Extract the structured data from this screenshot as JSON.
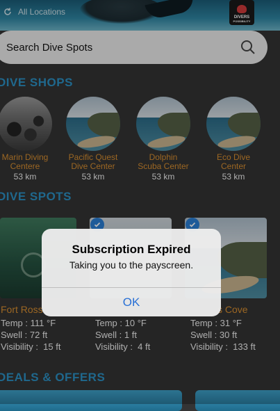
{
  "header": {
    "location_label": "All Locations",
    "badge_text_1": "DIVERS",
    "badge_text_2": "POSSIBILITY"
  },
  "search": {
    "placeholder": "Search Dive Spots"
  },
  "sections": {
    "shops": "DIVE SHOPS",
    "spots": "DIVE SPOTS",
    "deals": "DEALS & OFFERS"
  },
  "shops": [
    {
      "name_line1": "Marin Diving",
      "name_line2": "Centere",
      "distance": "53 km"
    },
    {
      "name_line1": "Pacific Quest",
      "name_line2": "Dive Center",
      "distance": "53 km"
    },
    {
      "name_line1": "Dolphin",
      "name_line2": "Scuba Center",
      "distance": "53 km"
    },
    {
      "name_line1": "Eco Dive",
      "name_line2": "Center",
      "distance": "53 km"
    }
  ],
  "spots": [
    {
      "name": "Fort Ross",
      "temp": "Temp : 111 °F",
      "swell": "Swell : 72 ft",
      "visibility": "Visibility :  15 ft"
    },
    {
      "name": "",
      "temp": "Temp : 10 °F",
      "swell": "Swell : 1 ft",
      "visibility": "Visibility :  4 ft"
    },
    {
      "name": "s Cove",
      "temp": "Temp : 31 °F",
      "swell": "Swell : 30 ft",
      "visibility": "Visibility :  133 ft"
    }
  ],
  "alert": {
    "title": "Subscription Expired",
    "message": "Taking you to the payscreen.",
    "ok_label": "OK"
  },
  "colors": {
    "accent_blue": "#2c90c4",
    "shop_orange": "#d98f31",
    "alert_button": "#2870d6"
  }
}
